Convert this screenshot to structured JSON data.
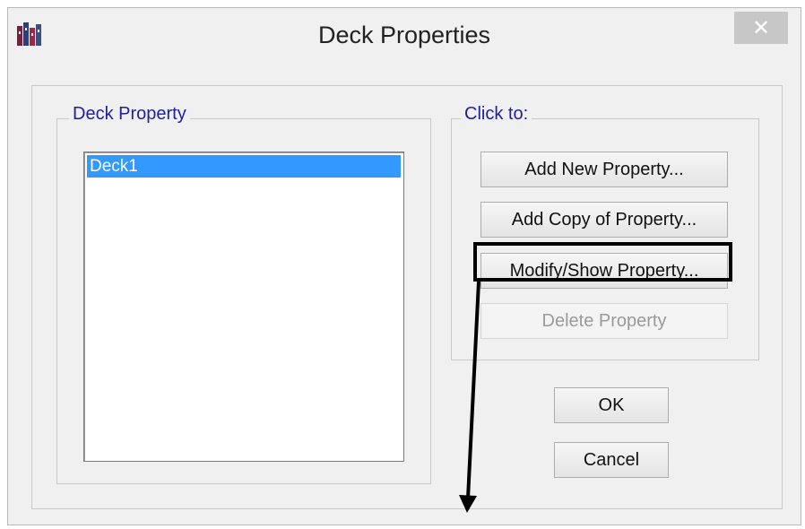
{
  "window": {
    "title": "Deck Properties",
    "close_symbol": "✕",
    "app_icon": "etabs-app-icon"
  },
  "deck_property": {
    "group_label": "Deck Property",
    "items": [
      {
        "label": "Deck1",
        "selected": true
      }
    ]
  },
  "click_to": {
    "group_label": "Click to:",
    "add_new_label": "Add New Property...",
    "add_copy_label": "Add Copy of Property...",
    "modify_label": "Modify/Show Property...",
    "delete_label": "Delete Property",
    "delete_enabled": false
  },
  "buttons": {
    "ok_label": "OK",
    "cancel_label": "Cancel"
  },
  "colors": {
    "selection": "#3399ff",
    "group_label": "#1e1e9e",
    "annotation": "#000000"
  }
}
